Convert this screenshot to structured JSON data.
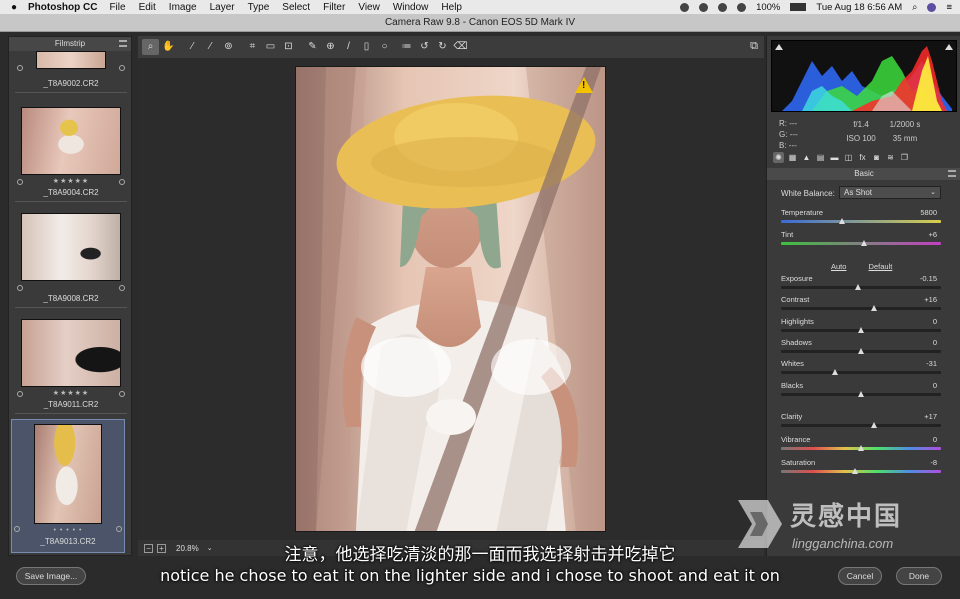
{
  "menubar": {
    "app_name": "Photoshop CC",
    "items": [
      "File",
      "Edit",
      "Image",
      "Layer",
      "Type",
      "Select",
      "Filter",
      "View",
      "Window",
      "Help"
    ],
    "battery": "100%",
    "datetime": "Tue Aug 18  6:56 AM"
  },
  "window": {
    "title": "Camera Raw 9.8  -  Canon EOS 5D Mark IV"
  },
  "filmstrip": {
    "title": "Filmstrip",
    "items": [
      {
        "name": "_T8A9002.CR2",
        "stars": ""
      },
      {
        "name": "_T8A9004.CR2",
        "stars": "★★★★★"
      },
      {
        "name": "_T8A9008.CR2",
        "stars": ""
      },
      {
        "name": "_T8A9011.CR2",
        "stars": "★★★★★"
      },
      {
        "name": "_T8A9013.CR2",
        "stars": "• • • • •"
      }
    ]
  },
  "toolbar": {
    "tools": [
      "zoom-tool-icon",
      "hand-tool-icon",
      "white-balance-tool-icon",
      "color-sampler-tool-icon",
      "targeted-adjustment-tool-icon",
      "crop-tool-icon",
      "straighten-tool-icon",
      "transform-tool-icon",
      "spot-removal-tool-icon",
      "red-eye-tool-icon",
      "adjustment-brush-icon",
      "graduated-filter-icon",
      "radial-filter-icon",
      "preferences-icon",
      "rotate-left-icon",
      "rotate-right-icon",
      "trash-icon"
    ]
  },
  "preview": {
    "zoom": "20.8%"
  },
  "info": {
    "r": "R:  ---",
    "g": "G:  ---",
    "b": "B:  ---",
    "aperture": "f/1.4",
    "shutter": "1/2000 s",
    "iso": "ISO 100",
    "focal": "35 mm"
  },
  "basic": {
    "title": "Basic",
    "white_balance_label": "White Balance:",
    "white_balance_value": "As Shot",
    "auto": "Auto",
    "default": "Default",
    "sliders": [
      {
        "label": "Temperature",
        "value": "5800",
        "pos": 0.38
      },
      {
        "label": "Tint",
        "value": "+6",
        "pos": 0.52
      },
      {
        "label": "Exposure",
        "value": "-0.15",
        "pos": 0.48
      },
      {
        "label": "Contrast",
        "value": "+16",
        "pos": 0.58
      },
      {
        "label": "Highlights",
        "value": "0",
        "pos": 0.5
      },
      {
        "label": "Shadows",
        "value": "0",
        "pos": 0.5
      },
      {
        "label": "Whites",
        "value": "-31",
        "pos": 0.34
      },
      {
        "label": "Blacks",
        "value": "0",
        "pos": 0.5
      },
      {
        "label": "Clarity",
        "value": "+17",
        "pos": 0.58
      },
      {
        "label": "Vibrance",
        "value": "0",
        "pos": 0.5
      },
      {
        "label": "Saturation",
        "value": "-8",
        "pos": 0.46
      }
    ]
  },
  "buttons": {
    "save_image": "Save Image...",
    "cancel": "Cancel",
    "done": "Done"
  },
  "subtitles": {
    "chinese": "注意，他选择吃清淡的那一面而我选择射击并吃掉它",
    "english": "notice he chose to eat it on the lighter side and i chose to shoot and eat it on"
  },
  "watermark": {
    "chinese": "灵感中国",
    "site": "lingganchina.com"
  }
}
